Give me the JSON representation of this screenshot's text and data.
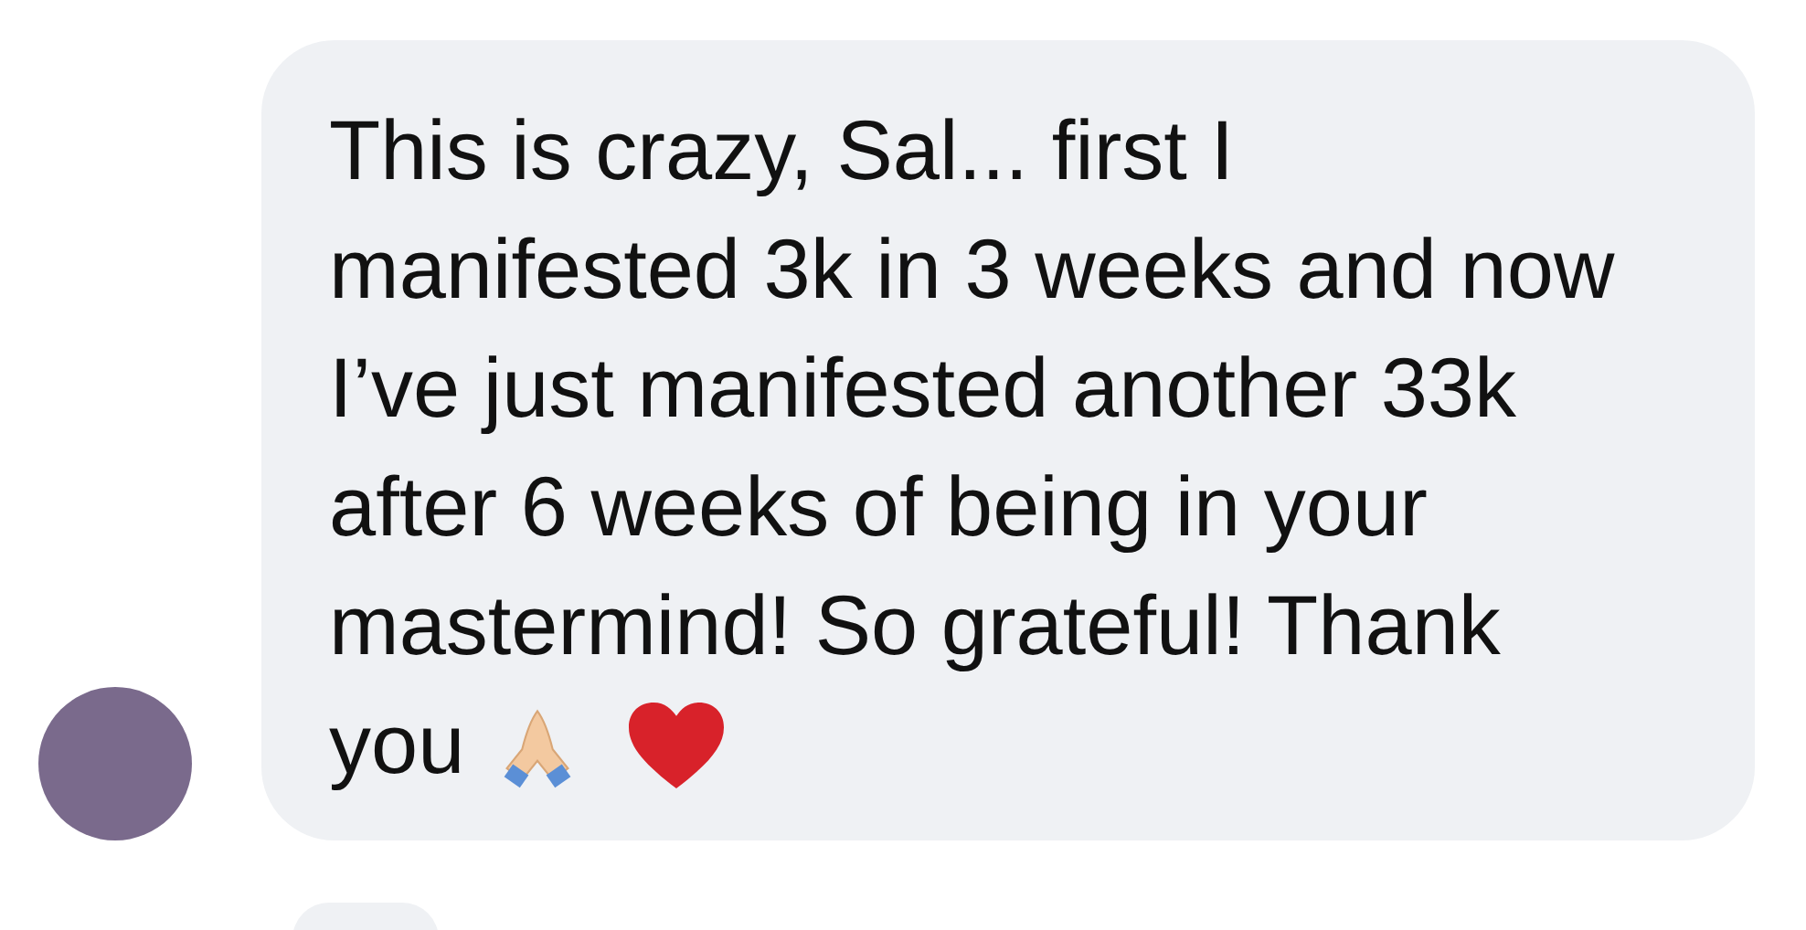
{
  "messages": [
    {
      "lines": [
        "This is crazy, Sal... first I",
        "manifested 3k in 3 weeks and now",
        "I’ve just manifested another 33k",
        "after 6 weeks of being in your",
        "mastermind! So grateful! Thank",
        "you"
      ]
    }
  ]
}
